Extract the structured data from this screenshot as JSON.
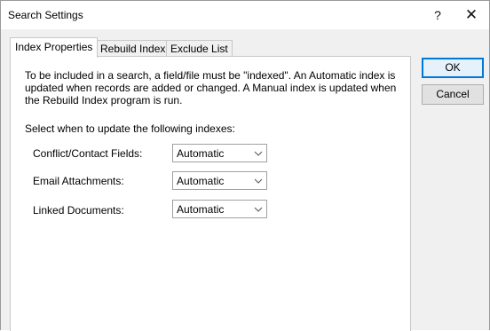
{
  "window": {
    "title": "Search Settings",
    "help_label": "?",
    "close_label": "✕"
  },
  "tabs": [
    {
      "label": "Index Properties",
      "active": true
    },
    {
      "label": "Rebuild Index",
      "active": false
    },
    {
      "label": "Exclude List",
      "active": false
    }
  ],
  "panel": {
    "description": "To be included in a search, a field/file must be \"indexed\".  An Automatic index is updated when records are added or changed.  A Manual index is updated when the Rebuild Index program is run.",
    "prompt": "Select when to update the following indexes:",
    "rows": [
      {
        "label": "Conflict/Contact Fields:",
        "value": "Automatic"
      },
      {
        "label": "Email Attachments:",
        "value": "Automatic"
      },
      {
        "label": "Linked Documents:",
        "value": "Automatic"
      }
    ]
  },
  "buttons": {
    "ok_label": "OK",
    "cancel_label": "Cancel"
  },
  "colors": {
    "accent": "#0078d7",
    "panel_bg": "#ffffff",
    "dialog_bg": "#f0f0f0"
  }
}
